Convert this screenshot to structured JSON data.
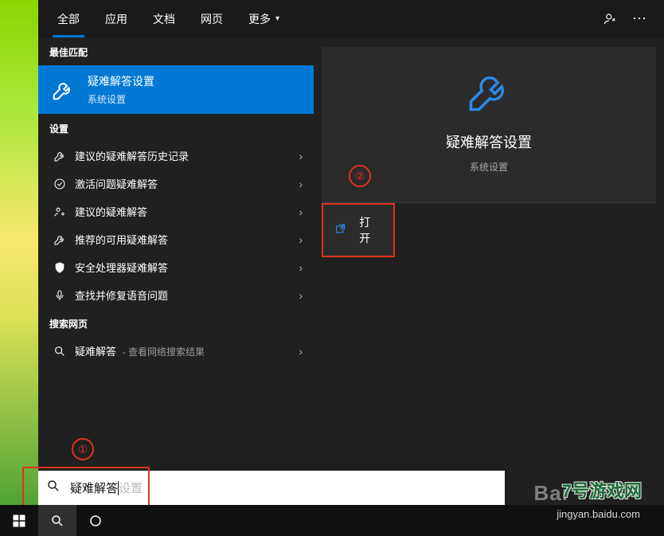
{
  "tabs": {
    "all": "全部",
    "apps": "应用",
    "docs": "文档",
    "web": "网页",
    "more": "更多"
  },
  "sections": {
    "best_match": "最佳匹配",
    "settings": "设置",
    "search_web": "搜索网页"
  },
  "best_match": {
    "title": "疑难解答设置",
    "subtitle": "系统设置"
  },
  "settings_items": [
    {
      "label": "建议的疑难解答历史记录"
    },
    {
      "label": "激活问题疑难解答"
    },
    {
      "label": "建议的疑难解答"
    },
    {
      "label": "推荐的可用疑难解答"
    },
    {
      "label": "安全处理器疑难解答"
    },
    {
      "label": "查找并修复语音问题"
    }
  ],
  "web_item": {
    "label": "疑难解答",
    "suffix": "- 查看网络搜索结果"
  },
  "preview": {
    "title": "疑难解答设置",
    "subtitle": "系统设置",
    "open": "打开"
  },
  "annotations": {
    "step1": "①",
    "step2": "②"
  },
  "search": {
    "typed": "疑难解答",
    "ghost": "设置"
  },
  "watermark": {
    "logo": "7号游戏网",
    "url": "jingyan.baidu.com",
    "ba": "Bai"
  }
}
